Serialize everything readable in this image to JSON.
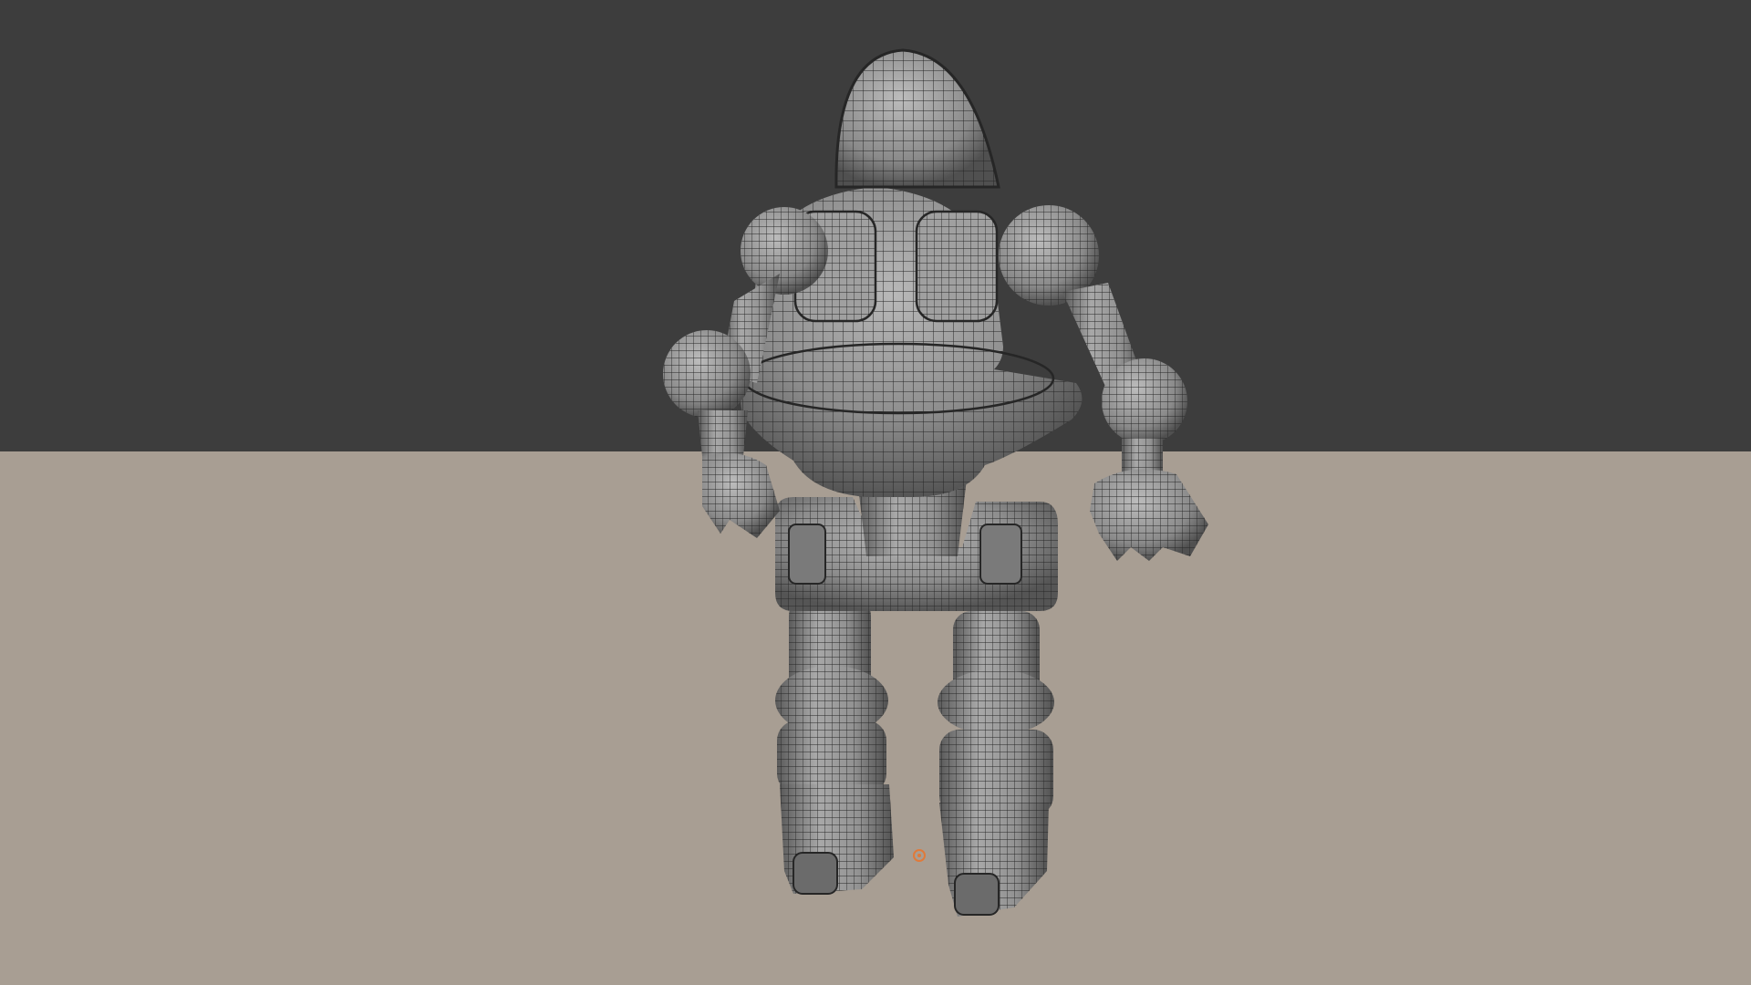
{
  "viewport": {
    "wall_color": "#3d3d3d",
    "floor_color": "#a89e93",
    "mesh_fill": "#8f8f8f",
    "mesh_light": "#b3b3b3",
    "mesh_dark": "#4e4e4e",
    "wire_color": "#262626",
    "origin_color": "#e07a3a"
  },
  "model": {
    "display_mode": "wireframe-overlay",
    "icon": "robot-mesh"
  }
}
